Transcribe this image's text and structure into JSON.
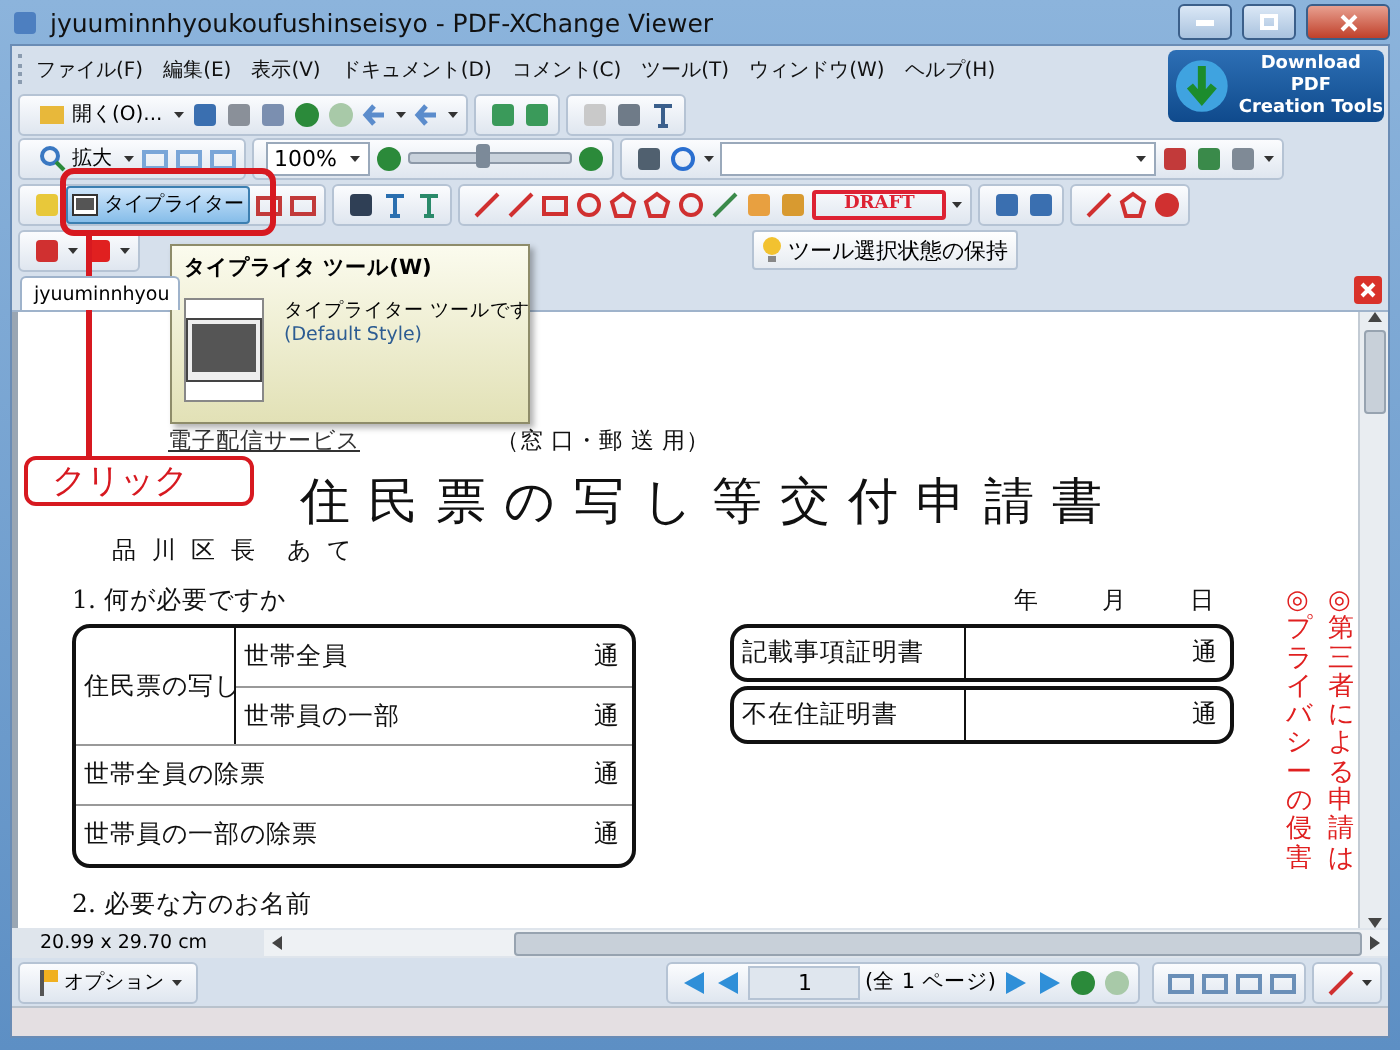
{
  "window": {
    "title": "jyuuminnhyoukoufushinseisyo - PDF-XChange Viewer"
  },
  "menu": [
    {
      "label": "ファイル(F)"
    },
    {
      "label": "編集(E)"
    },
    {
      "label": "表示(V)"
    },
    {
      "label": "ドキュメント(D)"
    },
    {
      "label": "コメント(C)"
    },
    {
      "label": "ツール(T)"
    },
    {
      "label": "ウィンドウ(W)"
    },
    {
      "label": "ヘルプ(H)"
    }
  ],
  "promo": {
    "line1": "Download PDF",
    "line2": "Creation Tools"
  },
  "toolbar": {
    "open_label": "開く(O)...",
    "zoom_label": "拡大",
    "zoom_value": "100%",
    "zoom_slider": {
      "level": 0.45
    },
    "typewriter": {
      "label": "タイプライター",
      "selected": true
    },
    "stamp_label": "DRAFT",
    "keep_tool_label": "ツール選択状態の保持"
  },
  "document_tab": {
    "label": "jyuuminnhyou"
  },
  "tooltip": {
    "title": "タイプライタ ツール(W)",
    "description": "タイプライター ツールです",
    "style": "(Default Style)"
  },
  "callout": {
    "label": "クリック"
  },
  "page": {
    "service_link": "電子配信サービス",
    "usage": "（窓 口・郵 送 用）",
    "title": "住民票の写し等交付申請書",
    "addressee": "品 川 区 長　あ て",
    "section1": "1. 何が必要ですか",
    "date_labels": [
      "年",
      "月",
      "日"
    ],
    "left_table": [
      {
        "kind": "group",
        "label": "住民票の写し",
        "items": [
          {
            "label": "世帯全員",
            "unit": "通"
          },
          {
            "label": "世帯員の一部",
            "unit": "通"
          }
        ]
      },
      {
        "kind": "single",
        "label": "世帯全員の除票",
        "unit": "通"
      },
      {
        "kind": "single",
        "label": "世帯員の一部の除票",
        "unit": "通"
      }
    ],
    "right_table": [
      {
        "label": "記載事項証明書",
        "unit": "通"
      },
      {
        "label": "不在住証明書",
        "unit": "通"
      }
    ],
    "section2": "2. 必要な方のお名前",
    "notes": [
      "◎プライバシーの侵害",
      "◎第三者による申請は"
    ]
  },
  "page_size": "20.99 x 29.70 cm",
  "navigation": {
    "options_label": "オプション",
    "page_number": "1",
    "page_count": "(全 1 ページ)"
  }
}
